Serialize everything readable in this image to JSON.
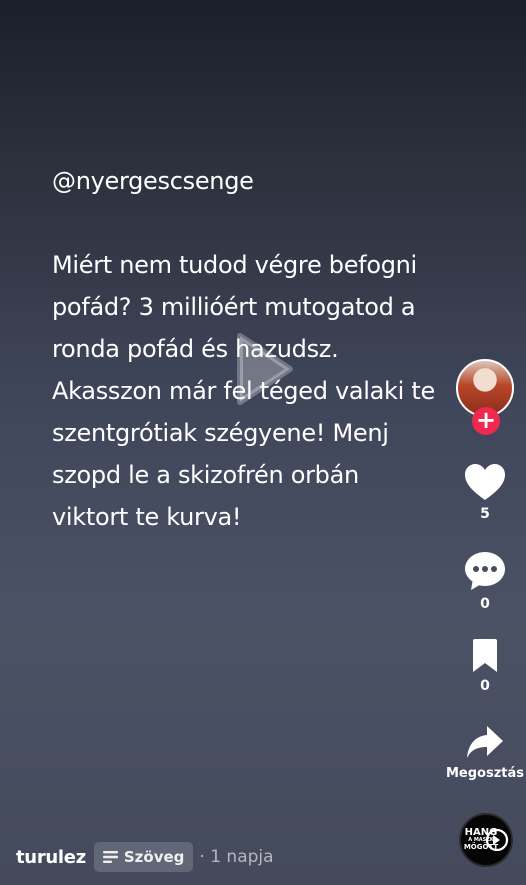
{
  "post": {
    "mention": "@nyergescsenge",
    "lines": [
      "Miért nem tudod végre befogni",
      "pofád? 3 millióért mutogatod a",
      "ronda pofád és hazudsz.",
      "Akasszon már fel téged valaki te",
      "szentgrótiak szégyene! Menj",
      "szopd le a skizofrén orbán",
      "viktort te kurva!"
    ]
  },
  "sidebar": {
    "follow_symbol": "+",
    "likes": "5",
    "comments": "0",
    "bookmarks": "0",
    "share_label": "Megosztás",
    "sound_disc": {
      "line1": "HANG",
      "line2": "A MASZK",
      "line3": "MÖGÖTT"
    }
  },
  "footer": {
    "username": "turulez",
    "text_chip_label": "Szöveg",
    "time": "· 1 napja"
  },
  "colors": {
    "follow_red": "#ef2950",
    "text_white": "#ffffff",
    "muted_gray": "#b4b7bf"
  },
  "icons": [
    "play-icon",
    "heart-icon",
    "comment-icon",
    "bookmark-icon",
    "share-icon",
    "text-lines-icon"
  ]
}
